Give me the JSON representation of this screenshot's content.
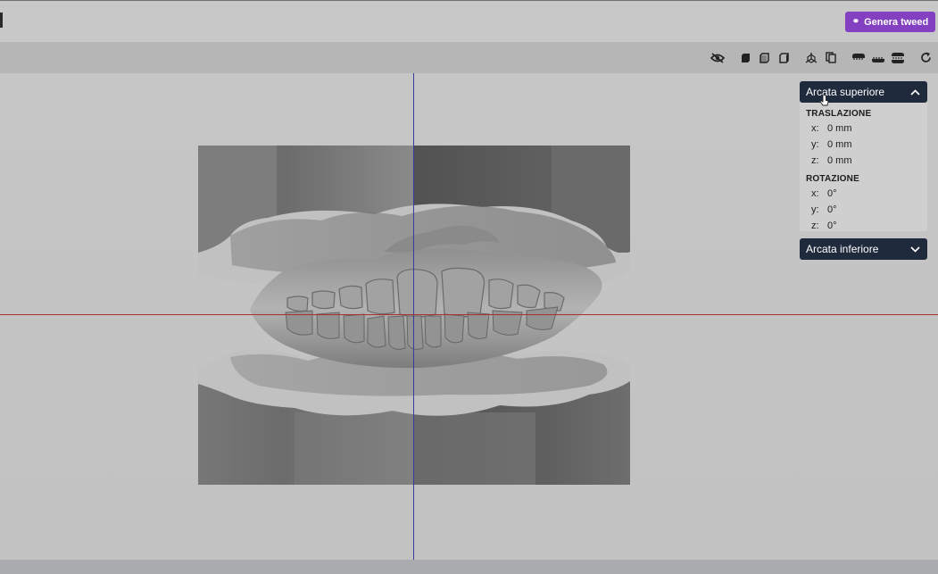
{
  "header": {
    "generate_button": {
      "label": "Genera tweed",
      "icon": "link-icon"
    }
  },
  "toolbar": {
    "buttons": [
      {
        "name": "visibility-off-icon"
      },
      {
        "name": "cube-solid-icon"
      },
      {
        "name": "cube-front-icon"
      },
      {
        "name": "cube-side-icon"
      },
      {
        "name": "axes-view-icon"
      },
      {
        "name": "copy-view-icon"
      },
      {
        "name": "upper-arch-icon"
      },
      {
        "name": "lower-arch-icon"
      },
      {
        "name": "both-arches-icon"
      },
      {
        "name": "reset-icon"
      }
    ]
  },
  "panel": {
    "upper": {
      "title": "Arcata superiore",
      "translation_title": "TRASLAZIONE",
      "translation": [
        {
          "axis": "x:",
          "value": "0 mm"
        },
        {
          "axis": "y:",
          "value": "0 mm"
        },
        {
          "axis": "z:",
          "value": "0 mm"
        }
      ],
      "rotation_title": "ROTAZIONE",
      "rotation": [
        {
          "axis": "x:",
          "value": "0°"
        },
        {
          "axis": "y:",
          "value": "0°"
        },
        {
          "axis": "z:",
          "value": "0°"
        }
      ]
    },
    "lower": {
      "title": "Arcata inferiore"
    }
  },
  "colors": {
    "accent": "#8340c0",
    "panel_header": "#1f2a3c",
    "axis_x": "#a83030",
    "axis_y": "#3a3a9a"
  }
}
